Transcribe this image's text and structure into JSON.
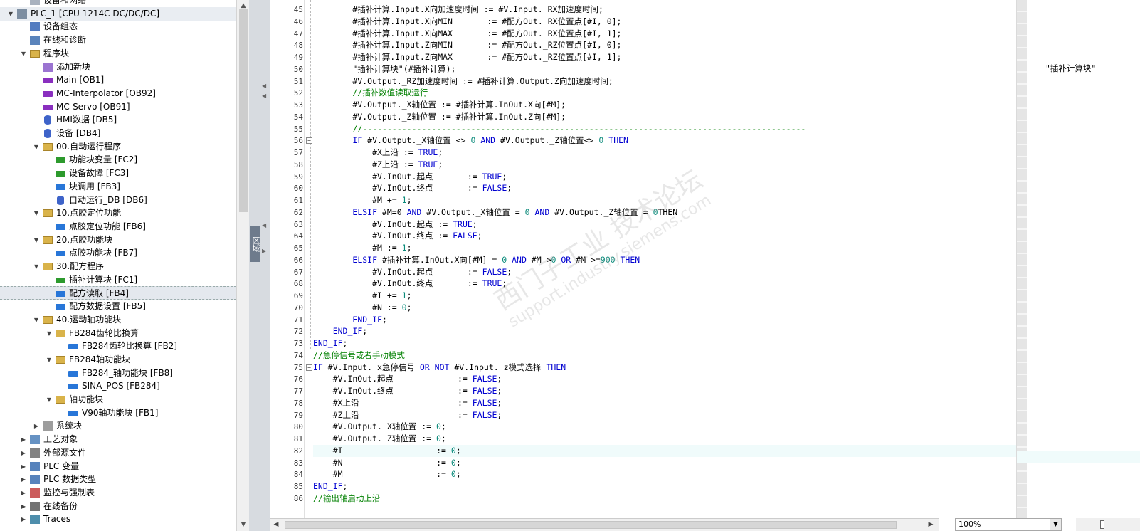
{
  "tree": {
    "items": [
      {
        "label": "设备和网络",
        "level": 1,
        "expander": "none",
        "icon": "network-icon"
      },
      {
        "label": "PLC_1 [CPU 1214C DC/DC/DC]",
        "level": 0,
        "expander": "open",
        "icon": "plc-icon"
      },
      {
        "label": "设备组态",
        "level": 1,
        "expander": "none",
        "icon": "device-config-icon"
      },
      {
        "label": "在线和诊断",
        "level": 1,
        "expander": "none",
        "icon": "diagnostics-icon"
      },
      {
        "label": "程序块",
        "level": 1,
        "expander": "open",
        "icon": "folder-icon"
      },
      {
        "label": "添加新块",
        "level": 2,
        "expander": "none",
        "icon": "add-block-icon"
      },
      {
        "label": "Main [OB1]",
        "level": 2,
        "expander": "none",
        "icon": "ob-icon"
      },
      {
        "label": "MC-Interpolator [OB92]",
        "level": 2,
        "expander": "none",
        "icon": "ob-icon"
      },
      {
        "label": "MC-Servo [OB91]",
        "level": 2,
        "expander": "none",
        "icon": "ob-icon"
      },
      {
        "label": "HMI数据 [DB5]",
        "level": 2,
        "expander": "none",
        "icon": "db-icon"
      },
      {
        "label": "设备 [DB4]",
        "level": 2,
        "expander": "none",
        "icon": "db-icon"
      },
      {
        "label": "00.自动运行程序",
        "level": 2,
        "expander": "open",
        "icon": "folder-icon"
      },
      {
        "label": "功能块变量 [FC2]",
        "level": 3,
        "expander": "none",
        "icon": "fc-icon"
      },
      {
        "label": "设备故障 [FC3]",
        "level": 3,
        "expander": "none",
        "icon": "fc-icon"
      },
      {
        "label": "块调用 [FB3]",
        "level": 3,
        "expander": "none",
        "icon": "fb-icon"
      },
      {
        "label": "自动运行_DB [DB6]",
        "level": 3,
        "expander": "none",
        "icon": "db-icon"
      },
      {
        "label": "10.点胶定位功能",
        "level": 2,
        "expander": "open",
        "icon": "folder-icon"
      },
      {
        "label": "点胶定位功能 [FB6]",
        "level": 3,
        "expander": "none",
        "icon": "fb-icon"
      },
      {
        "label": "20.点胶功能块",
        "level": 2,
        "expander": "open",
        "icon": "folder-icon"
      },
      {
        "label": "点胶功能块 [FB7]",
        "level": 3,
        "expander": "none",
        "icon": "fb-icon"
      },
      {
        "label": "30.配方程序",
        "level": 2,
        "expander": "open",
        "icon": "folder-icon"
      },
      {
        "label": "插补计算块 [FC1]",
        "level": 3,
        "expander": "none",
        "icon": "fc-icon"
      },
      {
        "label": "配方读取 [FB4]",
        "level": 3,
        "expander": "none",
        "icon": "fb-icon",
        "selected": true
      },
      {
        "label": "配方数据设置 [FB5]",
        "level": 3,
        "expander": "none",
        "icon": "fb-icon"
      },
      {
        "label": "40.运动轴功能块",
        "level": 2,
        "expander": "open",
        "icon": "folder-icon"
      },
      {
        "label": "FB284齿轮比换算",
        "level": 3,
        "expander": "open",
        "icon": "folder-icon"
      },
      {
        "label": "FB284齿轮比换算 [FB2]",
        "level": 4,
        "expander": "none",
        "icon": "fb-icon"
      },
      {
        "label": "FB284轴功能块",
        "level": 3,
        "expander": "open",
        "icon": "folder-icon"
      },
      {
        "label": "FB284_轴功能块 [FB8]",
        "level": 4,
        "expander": "none",
        "icon": "fb-icon"
      },
      {
        "label": "SINA_POS [FB284]",
        "level": 4,
        "expander": "none",
        "icon": "fb-icon"
      },
      {
        "label": "轴功能块",
        "level": 3,
        "expander": "open",
        "icon": "folder-icon"
      },
      {
        "label": "V90轴功能块 [FB1]",
        "level": 4,
        "expander": "none",
        "icon": "fb-icon"
      },
      {
        "label": "系统块",
        "level": 2,
        "expander": "closed",
        "icon": "system-blocks-icon"
      },
      {
        "label": "工艺对象",
        "level": 1,
        "expander": "closed",
        "icon": "tech-object-icon"
      },
      {
        "label": "外部源文件",
        "level": 1,
        "expander": "closed",
        "icon": "source-file-icon"
      },
      {
        "label": "PLC 变量",
        "level": 1,
        "expander": "closed",
        "icon": "plc-tag-icon"
      },
      {
        "label": "PLC 数据类型",
        "level": 1,
        "expander": "closed",
        "icon": "plc-datatype-icon"
      },
      {
        "label": "监控与强制表",
        "level": 1,
        "expander": "closed",
        "icon": "watch-table-icon"
      },
      {
        "label": "在线备份",
        "level": 1,
        "expander": "closed",
        "icon": "online-backup-icon"
      },
      {
        "label": "Traces",
        "level": 1,
        "expander": "closed",
        "icon": "traces-icon"
      }
    ]
  },
  "splitter": {
    "collapse_label": "区域"
  },
  "editor": {
    "current_line": 82,
    "lines": [
      {
        "n": 45,
        "text": "        #插补计算.Input.X向加速度时间 := #V.Input._RX加速度时间;"
      },
      {
        "n": 46,
        "text": "        #插补计算.Input.X向MIN       := #配方Out._RX位置点[#I, 0];"
      },
      {
        "n": 47,
        "text": "        #插补计算.Input.X向MAX       := #配方Out._RX位置点[#I, 1];"
      },
      {
        "n": 48,
        "text": "        #插补计算.Input.Z向MIN       := #配方Out._RZ位置点[#I, 0];"
      },
      {
        "n": 49,
        "text": "        #插补计算.Input.Z向MAX       := #配方Out._RZ位置点[#I, 1];"
      },
      {
        "n": 50,
        "text": "        \"插补计算块\"(#插补计算);"
      },
      {
        "n": 51,
        "text": "        #V.Output._RZ加速度时间 := #插补计算.Output.Z向加速度时间;"
      },
      {
        "n": 52,
        "text": "        //插补数值读取运行",
        "type": "comment"
      },
      {
        "n": 53,
        "text": "        #V.Output._X轴位置 := #插补计算.InOut.X向[#M];"
      },
      {
        "n": 54,
        "text": "        #V.Output._Z轴位置 := #插补计算.InOut.Z向[#M];"
      },
      {
        "n": 55,
        "text": "        //------------------------------------------------------------------------------------------",
        "type": "comment"
      },
      {
        "n": 56,
        "text": "        IF #V.Output._X轴位置 <> 0 AND #V.Output._Z轴位置<> 0 THEN",
        "type": "keyword",
        "fold": true
      },
      {
        "n": 57,
        "text": "            #X上沿 := TRUE;"
      },
      {
        "n": 58,
        "text": "            #Z上沿 := TRUE;"
      },
      {
        "n": 59,
        "text": "            #V.InOut.起点       := TRUE;"
      },
      {
        "n": 60,
        "text": "            #V.InOut.终点       := FALSE;"
      },
      {
        "n": 61,
        "text": "            #M += 1;"
      },
      {
        "n": 62,
        "text": "        ELSIF #M=0 AND #V.Output._X轴位置 = 0 AND #V.Output._Z轴位置 = 0THEN",
        "type": "keyword"
      },
      {
        "n": 63,
        "text": "            #V.InOut.起点 := TRUE;"
      },
      {
        "n": 64,
        "text": "            #V.InOut.终点 := FALSE;"
      },
      {
        "n": 65,
        "text": "            #M := 1;"
      },
      {
        "n": 66,
        "text": "        ELSIF #插补计算.InOut.X向[#M] = 0 AND #M >0 OR #M >=900 THEN",
        "type": "keyword"
      },
      {
        "n": 67,
        "text": "            #V.InOut.起点       := FALSE;"
      },
      {
        "n": 68,
        "text": "            #V.InOut.终点       := TRUE;"
      },
      {
        "n": 69,
        "text": "            #I += 1;"
      },
      {
        "n": 70,
        "text": "            #N := 0;"
      },
      {
        "n": 71,
        "text": "        END_IF;"
      },
      {
        "n": 72,
        "text": "    END_IF;"
      },
      {
        "n": 73,
        "text": "END_IF;"
      },
      {
        "n": 74,
        "text": "//急停信号或者手动模式",
        "type": "comment"
      },
      {
        "n": 75,
        "text": "IF #V.Input._x急停信号 OR NOT #V.Input._z模式选择 THEN",
        "type": "keyword",
        "fold": true
      },
      {
        "n": 76,
        "text": "    #V.InOut.起点             := FALSE;"
      },
      {
        "n": 77,
        "text": "    #V.InOut.终点             := FALSE;"
      },
      {
        "n": 78,
        "text": "    #X上沿                    := FALSE;"
      },
      {
        "n": 79,
        "text": "    #Z上沿                    := FALSE;"
      },
      {
        "n": 80,
        "text": "    #V.Output._X轴位置 := 0;"
      },
      {
        "n": 81,
        "text": "    #V.Output._Z轴位置 := 0;"
      },
      {
        "n": 82,
        "text": "    #I                   := 0;"
      },
      {
        "n": 83,
        "text": "    #N                   := 0;"
      },
      {
        "n": 84,
        "text": "    #M                   := 0;"
      },
      {
        "n": 85,
        "text": "END_IF;"
      },
      {
        "n": 86,
        "text": "//输出轴启动上沿",
        "type": "comment"
      }
    ]
  },
  "right_panel": {
    "annotation": "\"插补计算块\""
  },
  "watermark": {
    "line1": "西门子工业 技术论坛",
    "line2": "support.industry.siemens.com"
  },
  "statusbar": {
    "zoom": "100%"
  }
}
